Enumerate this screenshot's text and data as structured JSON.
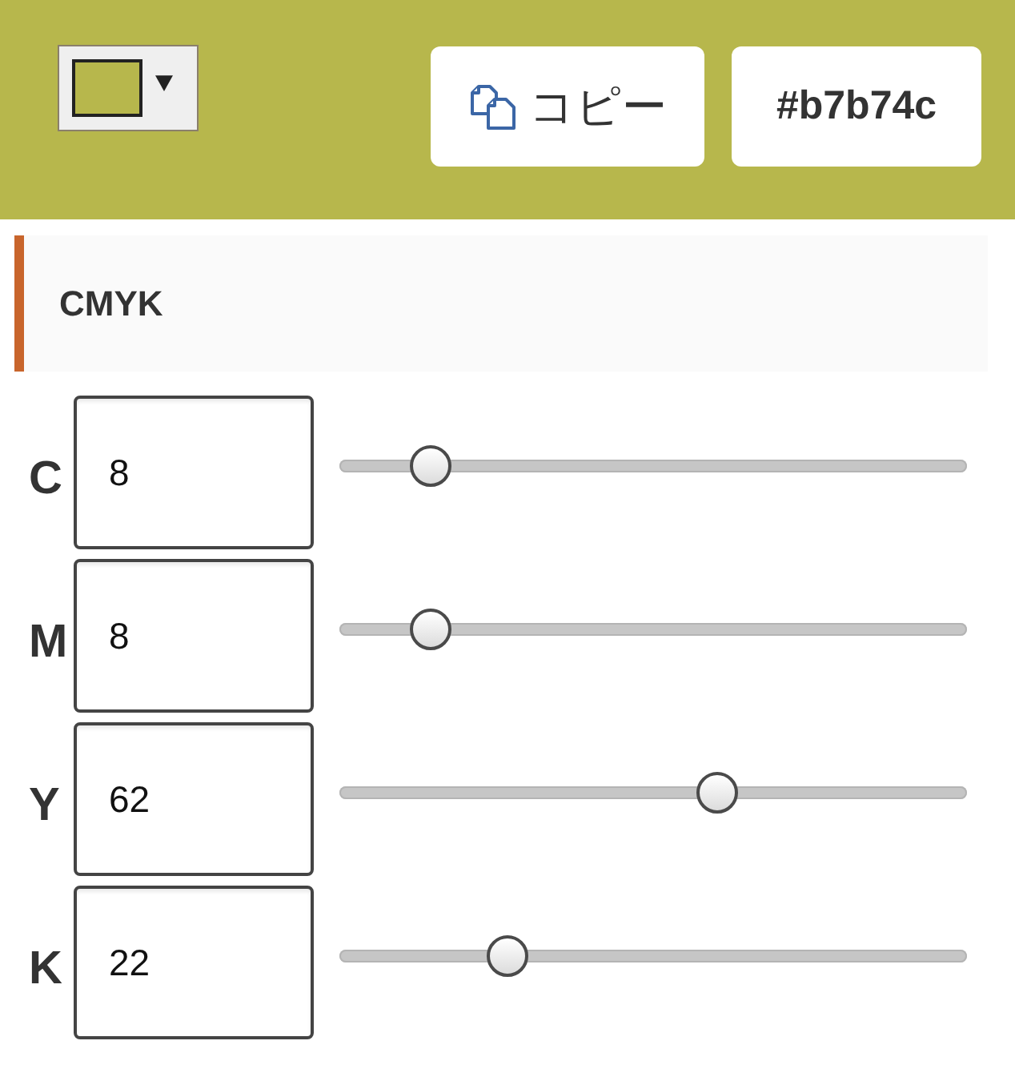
{
  "header": {
    "color_picker": {
      "color": "#b7b74c"
    },
    "copy_button": {
      "label": "コピー"
    },
    "hex_button": {
      "label": "#b7b74c"
    }
  },
  "section": {
    "title": "CMYK"
  },
  "channels": [
    {
      "label": "C",
      "value": "8",
      "level": 0.12
    },
    {
      "label": "M",
      "value": "8",
      "level": 0.12
    },
    {
      "label": "Y",
      "value": "62",
      "level": 0.61
    },
    {
      "label": "K",
      "value": "22",
      "level": 0.25
    }
  ]
}
